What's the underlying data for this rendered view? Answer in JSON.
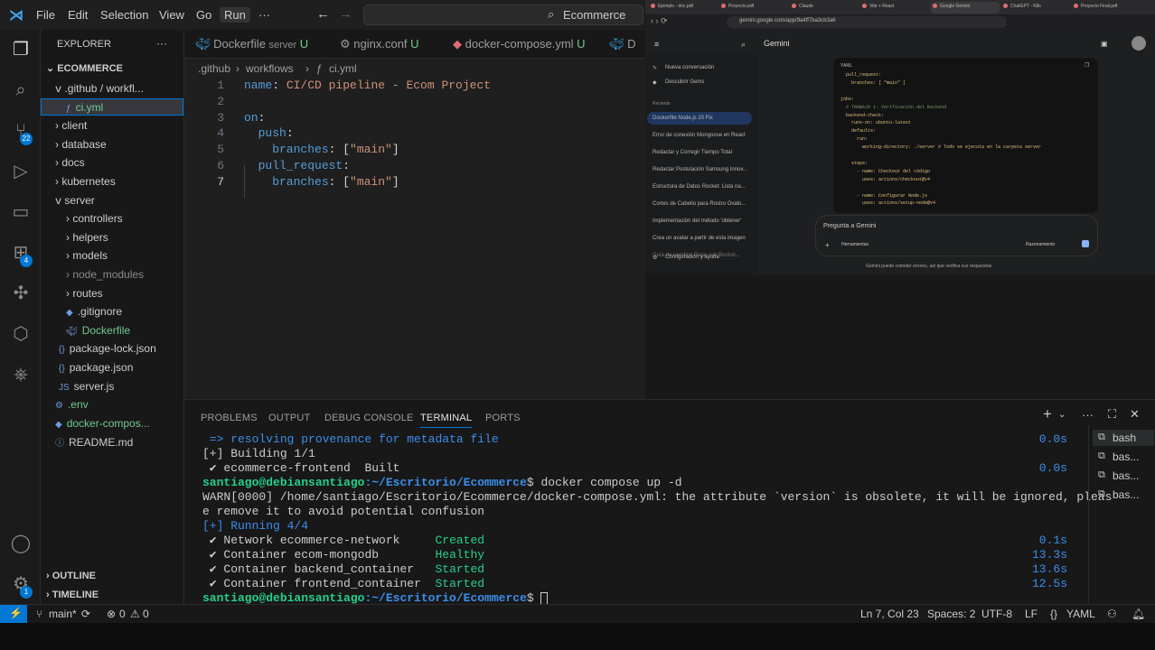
{
  "titlebar": {
    "menus": [
      "File",
      "Edit",
      "Selection",
      "View",
      "Go",
      "Run"
    ],
    "more": "···",
    "command_center": "Ecommerce"
  },
  "activity": {
    "scm_badge": "22",
    "ext_badge": "4",
    "settings_badge": "1"
  },
  "explorer": {
    "title": "EXPLORER",
    "more": "···",
    "root": "ECOMMERCE",
    "items": [
      {
        "label": "ⅴ .github / workfl...",
        "status": "dot"
      },
      {
        "label": "ci.yml",
        "status": "U"
      },
      {
        "label": "› client",
        "status": "dot"
      },
      {
        "label": "› database",
        "status": "dot"
      },
      {
        "label": "› docs",
        "status": ""
      },
      {
        "label": "› kubernetes",
        "status": ""
      },
      {
        "label": "ⅴ server",
        "status": "dot"
      },
      {
        "label": "› controllers",
        "status": ""
      },
      {
        "label": "› helpers",
        "status": ""
      },
      {
        "label": "› models",
        "status": ""
      },
      {
        "label": "› node_modules",
        "status": ""
      },
      {
        "label": "› routes",
        "status": ""
      },
      {
        "label": ".gitignore",
        "status": ""
      },
      {
        "label": "Dockerfile",
        "status": "U"
      },
      {
        "label": "package-lock.json",
        "status": ""
      },
      {
        "label": "package.json",
        "status": ""
      },
      {
        "label": "server.js",
        "status": ""
      },
      {
        "label": ".env",
        "status": "U"
      },
      {
        "label": "docker-compos...",
        "status": "U"
      },
      {
        "label": "README.md",
        "status": ""
      }
    ],
    "outline": "OUTLINE",
    "timeline": "TIMELINE"
  },
  "tabs": [
    {
      "label": "Dockerfile",
      "desc": "server",
      "status": "U"
    },
    {
      "label": "nginx.conf",
      "status": "U"
    },
    {
      "label": "docker-compose.yml",
      "status": "U"
    },
    {
      "label": "D"
    }
  ],
  "breadcrumb": [
    ".github",
    "workflows",
    "ci.yml"
  ],
  "editor": {
    "line_numbers": [
      "1",
      "2",
      "3",
      "4",
      "5",
      "6",
      "7"
    ],
    "lines": [
      [
        {
          "t": "name",
          "c": "k"
        },
        {
          "t": ": ",
          "c": "p"
        },
        {
          "t": "CI/CD pipeline - Ecom Project",
          "c": "s"
        }
      ],
      [],
      [
        {
          "t": "on",
          "c": "k"
        },
        {
          "t": ":",
          "c": "p"
        }
      ],
      [
        {
          "t": "  push",
          "c": "k"
        },
        {
          "t": ":",
          "c": "p"
        }
      ],
      [
        {
          "t": "    branches",
          "c": "k"
        },
        {
          "t": ": [",
          "c": "p"
        },
        {
          "t": "\"main\"",
          "c": "s"
        },
        {
          "t": "]",
          "c": "p"
        }
      ],
      [
        {
          "t": "  pull_request",
          "c": "k"
        },
        {
          "t": ":",
          "c": "p"
        }
      ],
      [
        {
          "t": "    branches",
          "c": "k"
        },
        {
          "t": ": [",
          "c": "p"
        },
        {
          "t": "\"main\"",
          "c": "s"
        },
        {
          "t": "]",
          "c": "p"
        }
      ]
    ]
  },
  "browser": {
    "tabs": [
      "Ejemplo - doc.pdf",
      "Proyecto.pdf",
      "Claude",
      "Vite + React",
      "Google Gemini",
      "ChatGPT - K8s",
      "Proyecto Final.pdf"
    ],
    "url": "gemini.google.com/app/9a4ff7ba3cb3a6",
    "app_title": "Gemini",
    "new_chat": "Nueva conversación",
    "explore": "Descubrir Gems",
    "recent_label": "Reciente",
    "recent": [
      "Dockerfile Node.js 20 Fix",
      "Error de conexión Mongoose en React",
      "Redactar y Corregir Tiempo Total",
      "Redactar Postulación Samsung Innov...",
      "Estructura de Datos Rocket: Lista na...",
      "Cortes de Cabello para Rostro Ovalo...",
      "Implementación del método 'obtener'",
      "Crea un avatar a partir de esta imagen",
      "Guía de Landing Page con Bootstr..."
    ],
    "settings": "Configuración y ayuda",
    "code_lang": "YAML",
    "code_lines": [
      "  pull_request:",
      "    branches: [ \"main\" ]",
      "",
      "jobs:",
      "  # TRABAJO 1: Verificación del Backend",
      "  backend-check:",
      "    runs-on: ubuntu-latest",
      "    defaults:",
      "      run:",
      "        working-directory: ./server # Todo se ejecuta en la carpeta server",
      "",
      "    steps:",
      "      - name: Checkout del código",
      "        uses: actions/checkout@v4",
      "",
      "      - name: Configurar Node.js",
      "        uses: actions/setup-node@v4"
    ],
    "input_placeholder": "Pregunta a Gemini",
    "tools": "Herramientas",
    "mode": "Razonamiento",
    "disclaimer": "Gemini puede cometer errores, así que verifica sus respuestas"
  },
  "panel": {
    "tabs": [
      "PROBLEMS",
      "OUTPUT",
      "DEBUG CONSOLE",
      "TERMINAL",
      "PORTS"
    ],
    "active_tab": "TERMINAL",
    "terminals": [
      "bash",
      "bas...",
      "bas...",
      "bas..."
    ],
    "lines": [
      {
        "text": " => resolving provenance for metadata file",
        "cls": "blue",
        "time": "0.0s"
      },
      {
        "text": "[+] Building 1/1",
        "cls": "",
        "time": ""
      },
      {
        "text": " ✔ ecommerce-frontend  Built",
        "cls": "",
        "time": "0.0s"
      },
      {
        "prompt": "santiago@debiansantiago",
        "path": ":~/Escritorio/Ecommerce",
        "cmd": "$ docker compose up -d"
      },
      {
        "text": "WARN[0000] /home/santiago/Escritorio/Ecommerce/docker-compose.yml: the attribute `version` is obsolete, it will be ignored, pleas",
        "cls": "warn",
        "time": ""
      },
      {
        "text": "e remove it to avoid potential confusion",
        "cls": "",
        "time": ""
      },
      {
        "text": "[+] Running 4/4",
        "cls": "blue",
        "time": ""
      },
      {
        "text": " ✔ Network ecommerce-network     ",
        "cls": "",
        "status": "Created",
        "time": "0.1s"
      },
      {
        "text": " ✔ Container ecom-mongodb        ",
        "cls": "",
        "status": "Healthy",
        "time": "13.3s"
      },
      {
        "text": " ✔ Container backend_container   ",
        "cls": "",
        "status": "Started",
        "time": "13.6s"
      },
      {
        "text": " ✔ Container frontend_container  ",
        "cls": "",
        "status": "Started",
        "time": "12.5s"
      },
      {
        "prompt": "santiago@debiansantiago",
        "path": ":~/Escritorio/Ecommerce",
        "cmd": "$ "
      }
    ]
  },
  "status": {
    "branch": "main*",
    "errors": "0",
    "warnings": "0",
    "position": "Ln 7, Col 23",
    "spaces": "Spaces: 2",
    "encoding": "UTF-8",
    "eol": "LF",
    "language": "YAML"
  },
  "colors": {
    "accent": "#0078d4",
    "keyword": "#569cd6",
    "string": "#ce9178",
    "git_untracked": "#73c991"
  }
}
